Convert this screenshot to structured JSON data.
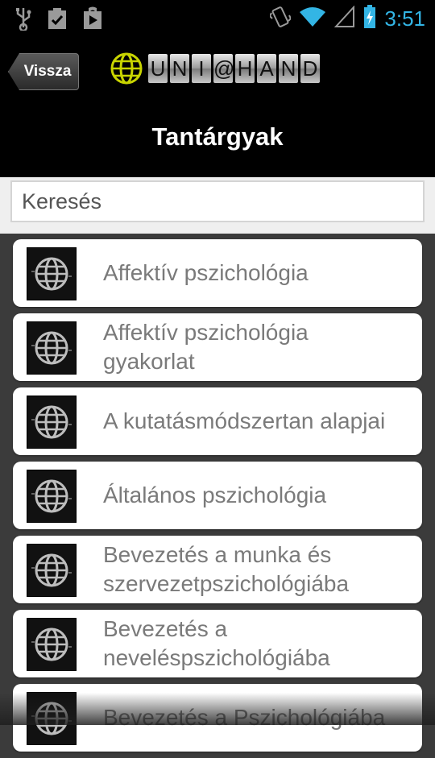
{
  "statusbar": {
    "time": "3:51",
    "icons": [
      "usb-icon",
      "clipboard-check-icon",
      "play-store-icon",
      "vibrate-icon",
      "wifi-icon",
      "signal-icon",
      "battery-charging-icon"
    ]
  },
  "header": {
    "back_label": "Vissza",
    "logo_letters": [
      "U",
      "N",
      "I",
      "@",
      "H",
      "A",
      "N",
      "D"
    ],
    "title": "Tantárgyak"
  },
  "search": {
    "placeholder": "Keresés"
  },
  "subjects": [
    {
      "label": "Affektív pszichológia"
    },
    {
      "label": "Affektív pszichológia\ngyakorlat"
    },
    {
      "label": "A kutatásmódszertan alapjai"
    },
    {
      "label": "Általános pszichológia"
    },
    {
      "label": "Bevezetés a munka és\nszervezetpszichológiába"
    },
    {
      "label": "Bevezetés a\nneveléspszichológiába"
    },
    {
      "label": "Bevezetés a Pszichológiába"
    }
  ],
  "colors": {
    "status_accent": "#33b5e5",
    "logo_globe": "#c8d400",
    "list_bg": "#3b3b3b",
    "item_text": "#7a7a7a"
  }
}
